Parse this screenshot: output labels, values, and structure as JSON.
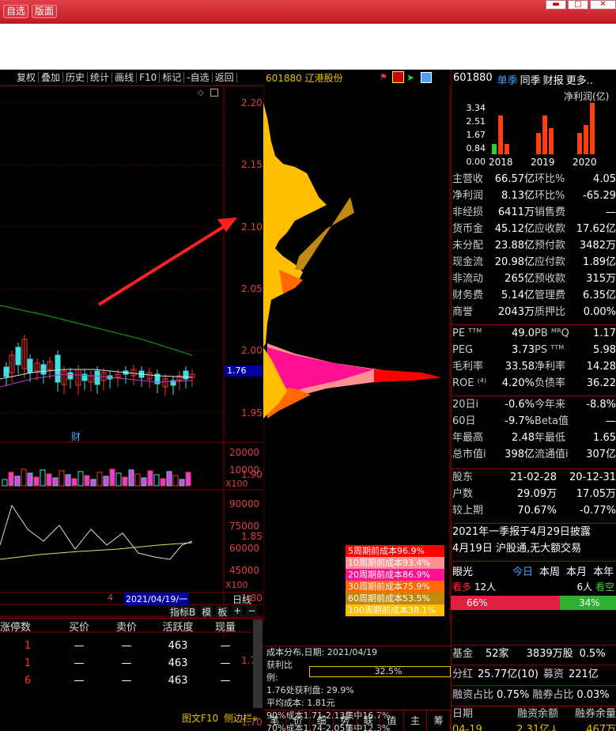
{
  "window": {
    "btn_zixuan": "自选",
    "btn_banmian": "版面"
  },
  "toolbar": [
    "复权",
    "叠加",
    "历史",
    "统计",
    "画线",
    "F10",
    "标记",
    "-自选",
    "返回"
  ],
  "stock": {
    "code": "601880",
    "name": "辽港股份"
  },
  "chart": {
    "price_axis": [
      "2.20",
      "2.15",
      "2.10",
      "2.05",
      "2.00",
      "1.95",
      "1.90",
      "1.85",
      "1.80",
      "1.75",
      "1.70"
    ],
    "current_price": "1.76",
    "event_mark": "财",
    "vol_axis": [
      "20000",
      "10000"
    ],
    "vol_unit": "X100",
    "ind_axis": [
      "90000",
      "75000",
      "60000",
      "45000"
    ],
    "ind_unit": "X100",
    "date_num": "4",
    "date_label": "2021/04/19/一",
    "period": "日线",
    "btns": [
      "指标B",
      "模",
      "板",
      "+",
      "−"
    ]
  },
  "cost_legend": [
    {
      "label": "5周期前成本96.9%",
      "color": "#ff0000"
    },
    {
      "label": "10周期前成本93.4%",
      "color": "#ff9090"
    },
    {
      "label": "20周期前成本86.9%",
      "color": "#ff1090"
    },
    {
      "label": "30周期前成本75.9%",
      "color": "#ff6a00"
    },
    {
      "label": "60周期前成本53.5%",
      "color": "#c08a10"
    },
    {
      "label": "100周期前成本38.1%",
      "color": "#ffbe00"
    }
  ],
  "cost_info": {
    "date_line": "成本分布,日期: 2021/04/19",
    "profit_label": "获利比例:",
    "profit_value": "32.5%",
    "profit_fill": 0.325,
    "line2": "1.76处获利盘: 29.9%",
    "line3": "平均成本: 1.81元",
    "line4": "90%成本1.71-2.13集中16.7%",
    "line5": "70%成本1.74-2.05集中12.3%"
  },
  "bottom_tabs": [
    "笔",
    "价",
    "细",
    "势",
    "联",
    "值",
    "主",
    "筹"
  ],
  "bottom_table": {
    "headers": [
      "涨停数",
      "买价",
      "卖价",
      "活跃度",
      "现量"
    ],
    "rows": [
      [
        "1",
        "—",
        "—",
        "463",
        "—"
      ],
      [
        "1",
        "—",
        "—",
        "463",
        "—"
      ],
      [
        "6",
        "—",
        "—",
        "463",
        "—"
      ]
    ],
    "footer": [
      "图文F10",
      "侧边栏»"
    ]
  },
  "right": {
    "code": "601880",
    "tabs": [
      "单季",
      "同季",
      "财报",
      "更多.."
    ],
    "profit_title": "净利润(亿)",
    "bar_axis": [
      "3.34",
      "2.51",
      "1.67",
      "0.84",
      "0.00"
    ],
    "years": [
      "2018",
      "2019",
      "2020"
    ],
    "fin": [
      [
        "主营收",
        "66.57亿",
        "环比%",
        "4.05"
      ],
      [
        "净利润",
        "8.13亿",
        "环比%",
        "-65.29"
      ],
      [
        "非经损",
        "6411万",
        "销售费",
        "—"
      ],
      [
        "货币金",
        "45.12亿",
        "应收款",
        "17.62亿"
      ],
      [
        "未分配",
        "23.88亿",
        "预付款",
        "3482万"
      ],
      [
        "现金流",
        "20.98亿",
        "应付款",
        "1.89亿"
      ],
      [
        "非流动",
        "265亿",
        "预收款",
        "315万"
      ],
      [
        "财务费",
        "5.14亿",
        "管理费",
        "6.35亿"
      ],
      [
        "商誉",
        "2043万",
        "质押比",
        "0.00%"
      ]
    ],
    "val": [
      [
        "PE ᵀᵀᴹ",
        "49.0",
        "PB ᴹᴿQ",
        "1.17"
      ],
      [
        "PEG",
        "3.73",
        "PS ᵀᵀᴹ",
        "5.98"
      ],
      [
        "毛利率",
        "33.58",
        "净利率",
        "14.28"
      ],
      [
        "ROE ⁽⁴⁾",
        "4.20%",
        "负债率",
        "36.22"
      ]
    ],
    "perf": [
      [
        "20日i",
        "-0.6%",
        "今年来",
        "-8.8%"
      ],
      [
        "60日",
        "-9.7%",
        "Beta值",
        "—"
      ],
      [
        "年最高",
        "2.48",
        "年最低",
        "1.65"
      ],
      [
        "总市值i",
        "398亿",
        "流通值i",
        "307亿"
      ]
    ],
    "holders": [
      [
        "股东",
        "21-02-28",
        "20-12-31"
      ],
      [
        "户数",
        "29.09万",
        "17.05万"
      ],
      [
        "较上期",
        "70.67%",
        "-0.77%"
      ]
    ],
    "news1": "2021年一季报于4月29日披露",
    "news2": "4月19日 沪股通,无大额交易",
    "eye": {
      "label": "眼光",
      "tabs": [
        "今日",
        "本周",
        "本月",
        "本年"
      ],
      "bull_label": "看多",
      "bull_count": "12人",
      "bear_count": "6人",
      "bear_label": "看空",
      "bull_pct": "66%",
      "bear_pct": "34%",
      "bull_frac": 0.66
    },
    "fund": {
      "label": "基金",
      "count": "52家",
      "shares": "3839万股",
      "pct": "0.5%"
    },
    "div": {
      "label": "分红",
      "value": "25.77亿(10)",
      "label2": "募资",
      "value2": "221亿"
    },
    "margin": {
      "label": "融资占比",
      "value": "0.75%",
      "label2": "融券占比",
      "value2": "0.03%"
    },
    "loan_head": [
      "日期",
      "融资余额",
      "融券余量"
    ],
    "loan_row": [
      "04-19",
      "2.31亿↓",
      "467万"
    ]
  }
}
